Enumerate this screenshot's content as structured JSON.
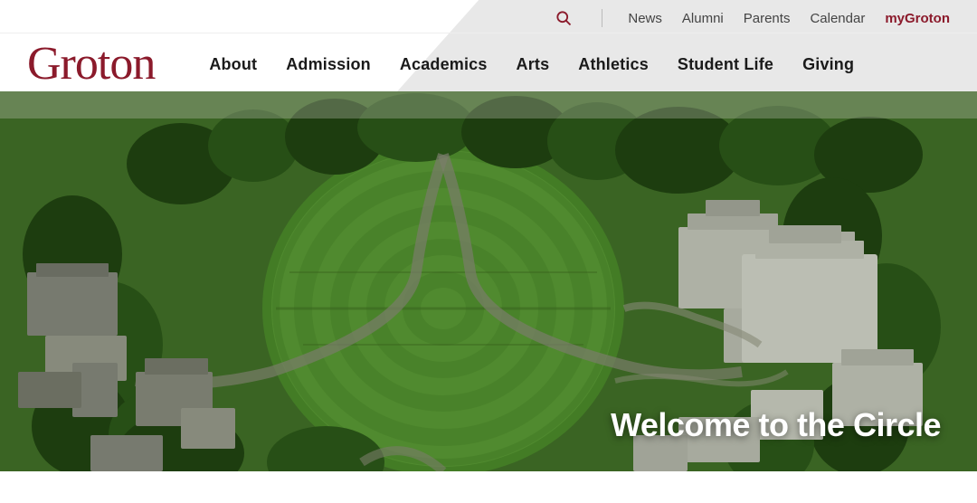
{
  "header": {
    "logo": "Groton",
    "topbar": {
      "links": [
        {
          "id": "news",
          "label": "News"
        },
        {
          "id": "alumni",
          "label": "Alumni"
        },
        {
          "id": "parents",
          "label": "Parents"
        },
        {
          "id": "calendar",
          "label": "Calendar"
        },
        {
          "id": "mygroton",
          "label": "myGroton",
          "accent": true
        }
      ]
    },
    "mainnav": {
      "links": [
        {
          "id": "about",
          "label": "About"
        },
        {
          "id": "admission",
          "label": "Admission"
        },
        {
          "id": "academics",
          "label": "Academics"
        },
        {
          "id": "arts",
          "label": "Arts"
        },
        {
          "id": "athletics",
          "label": "Athletics"
        },
        {
          "id": "student-life",
          "label": "Student Life"
        },
        {
          "id": "giving",
          "label": "Giving"
        }
      ]
    }
  },
  "hero": {
    "welcome_text": "Welcome to the Circle"
  },
  "colors": {
    "brand_red": "#8b1a2b",
    "nav_dark": "#1a1a1a"
  }
}
